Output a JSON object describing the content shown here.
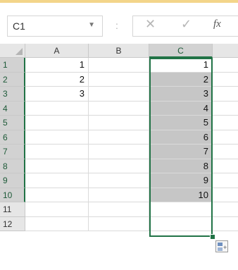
{
  "formula_bar": {
    "name_box": "C1",
    "name_box_dropdown_icon": "chevron-down-icon",
    "separator": ":",
    "cancel_icon": "✕",
    "enter_icon": "✓",
    "fx_label": "fx"
  },
  "columns": [
    "A",
    "B",
    "C"
  ],
  "rows": [
    "1",
    "2",
    "3",
    "4",
    "5",
    "6",
    "7",
    "8",
    "9",
    "10",
    "11",
    "12"
  ],
  "cells": {
    "A1": "1",
    "A2": "2",
    "A3": "3",
    "C1": "1",
    "C2": "2",
    "C3": "3",
    "C4": "4",
    "C5": "5",
    "C6": "6",
    "C7": "7",
    "C8": "8",
    "C9": "9",
    "C10": "10"
  },
  "selection": {
    "active_cell": "C1",
    "range": "C1:C10"
  },
  "colors": {
    "accent": "#217346",
    "selection_fill": "#c6c6c6",
    "header": "#e6e6e6"
  }
}
